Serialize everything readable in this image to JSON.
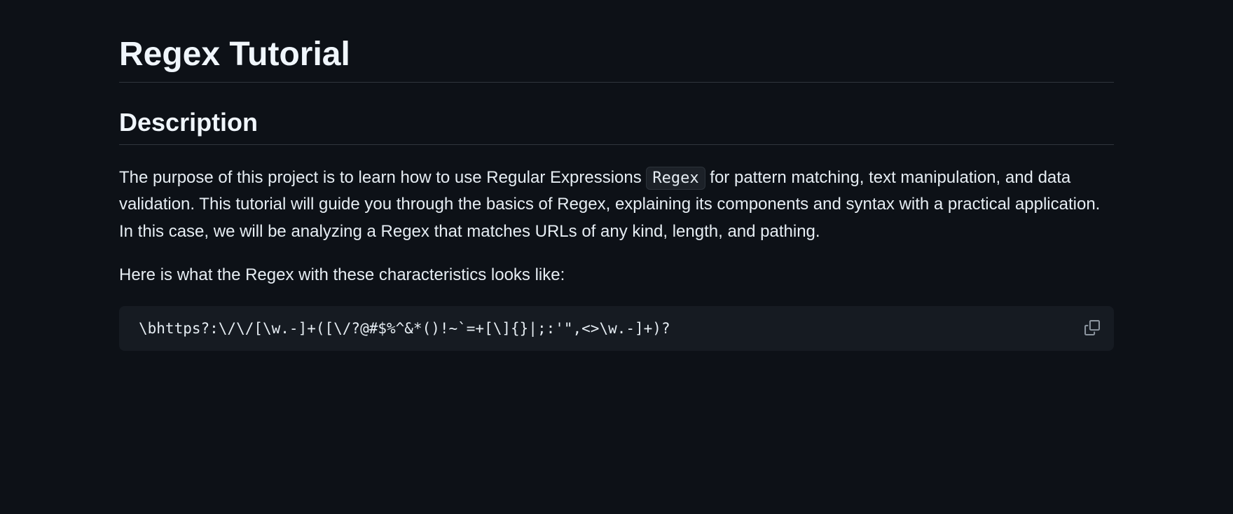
{
  "heading": "Regex Tutorial",
  "section": {
    "title": "Description",
    "paragraph1_pre": "The purpose of this project is to learn how to use Regular Expressions ",
    "inline_code": "Regex",
    "paragraph1_post": " for pattern matching, text manipulation, and data validation. This tutorial will guide you through the basics of Regex, explaining its components and syntax with a practical application. In this case, we will be analyzing a Regex that matches URLs of any kind, length, and pathing.",
    "paragraph2": "Here is what the Regex with these characteristics looks like:",
    "code": "\\bhttps?:\\/\\/[\\w.-]+([\\/?@#$%^&*()!~`=+[\\]{}|;:'\",<>\\w.-]+)?"
  }
}
